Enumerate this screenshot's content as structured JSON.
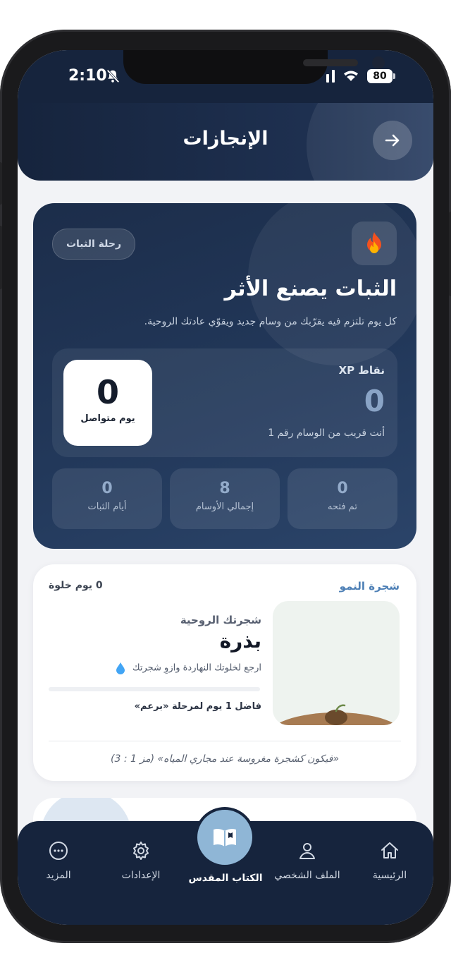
{
  "status_bar": {
    "time": "2:10",
    "battery": "80"
  },
  "header": {
    "title": "الإنجازات",
    "back_icon": "arrow-right-icon"
  },
  "hero": {
    "badge": "رحلة الثبات",
    "icon": "fire-icon",
    "title": "الثبات يصنع الأثر",
    "subtitle": "كل يوم تلتزم فيه يقرّبك من وسام جديد ويقوّي عادتك الروحية.",
    "xp_label": "نقاط XP",
    "xp_value": "0",
    "xp_next": "أنت قريب من الوسام رقم 1",
    "streak_value": "0",
    "streak_label": "يوم متواصل",
    "stats": [
      {
        "value": "0",
        "label": "تم فتحه"
      },
      {
        "value": "8",
        "label": "إجمالي الأوسام"
      },
      {
        "value": "0",
        "label": "أيام الثبات"
      }
    ]
  },
  "growth_tree": {
    "title": "شجرة النمو",
    "days": "0 يوم خلوة",
    "subtitle": "شجرتك الروحية",
    "stage": "بذرة",
    "hint": "ارجع لخلوتك النهاردة وازوِ شجرتك",
    "hint_icon": "water-drop-icon",
    "next_stage": "فاضل 1 يوم لمرحلة «برعم»",
    "progress": 0,
    "verse": "«فيكون كشجرة مغروسة عند مجاري المياه» (مز 1 : 3)"
  },
  "bottom_nav": {
    "items": [
      {
        "label": "الرئيسية",
        "icon": "home-icon"
      },
      {
        "label": "الملف الشخصي",
        "icon": "user-icon"
      },
      {
        "label": "الكتاب المقدس",
        "icon": "book-icon"
      },
      {
        "label": "الإعدادات",
        "icon": "gear-icon"
      },
      {
        "label": "المزيد",
        "icon": "more-icon"
      }
    ]
  },
  "colors": {
    "primary_dark": "#16243d",
    "accent_blue": "#8fb6d6",
    "link_blue": "#4e80b6"
  }
}
